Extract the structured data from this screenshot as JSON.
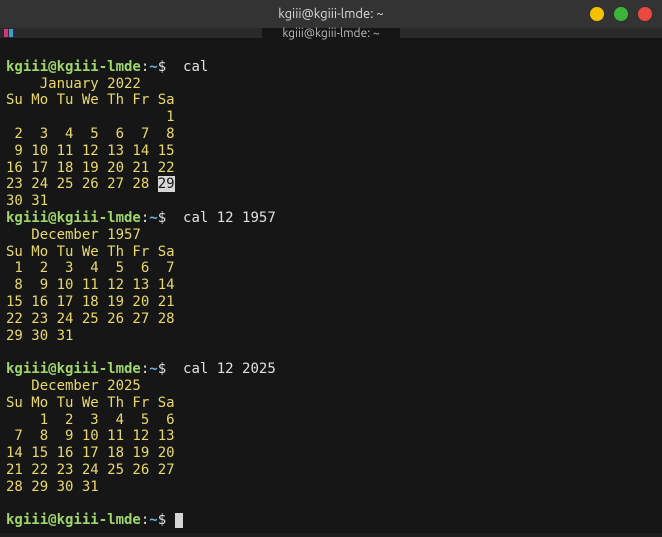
{
  "window": {
    "title": "kgiii@kgiii-lmde: ~",
    "tab_title": "kgiii@kgiii-lmde: ~"
  },
  "prompt": {
    "user_host": "kgiii@kgiii-lmde",
    "path": "~",
    "sep": ":",
    "symbol": "$"
  },
  "commands": {
    "c1": "cal",
    "c2": "cal 12 1957",
    "c3": "cal 12 2025",
    "c4": ""
  },
  "cal1": {
    "title": "    January 2022",
    "weekdays": "Su Mo Tu We Th Fr Sa",
    "r1a": "                   ",
    "r1b": "1",
    "r2": " 2  3  4  5  6  7  8",
    "r3": " 9 10 11 12 13 14 15",
    "r4": "16 17 18 19 20 21 22",
    "r5a": "23 24 25 26 27 28 ",
    "r5b": "29",
    "r6": "30 31"
  },
  "cal2": {
    "title": "   December 1957",
    "weekdays": "Su Mo Tu We Th Fr Sa",
    "r1": " 1  2  3  4  5  6  7",
    "r2": " 8  9 10 11 12 13 14",
    "r3": "15 16 17 18 19 20 21",
    "r4": "22 23 24 25 26 27 28",
    "r5": "29 30 31"
  },
  "cal3": {
    "title": "   December 2025",
    "weekdays": "Su Mo Tu We Th Fr Sa",
    "r1": "    1  2  3  4  5  6",
    "r2": " 7  8  9 10 11 12 13",
    "r3": "14 15 16 17 18 19 20",
    "r4": "21 22 23 24 25 26 27",
    "r5": "28 29 30 31"
  }
}
